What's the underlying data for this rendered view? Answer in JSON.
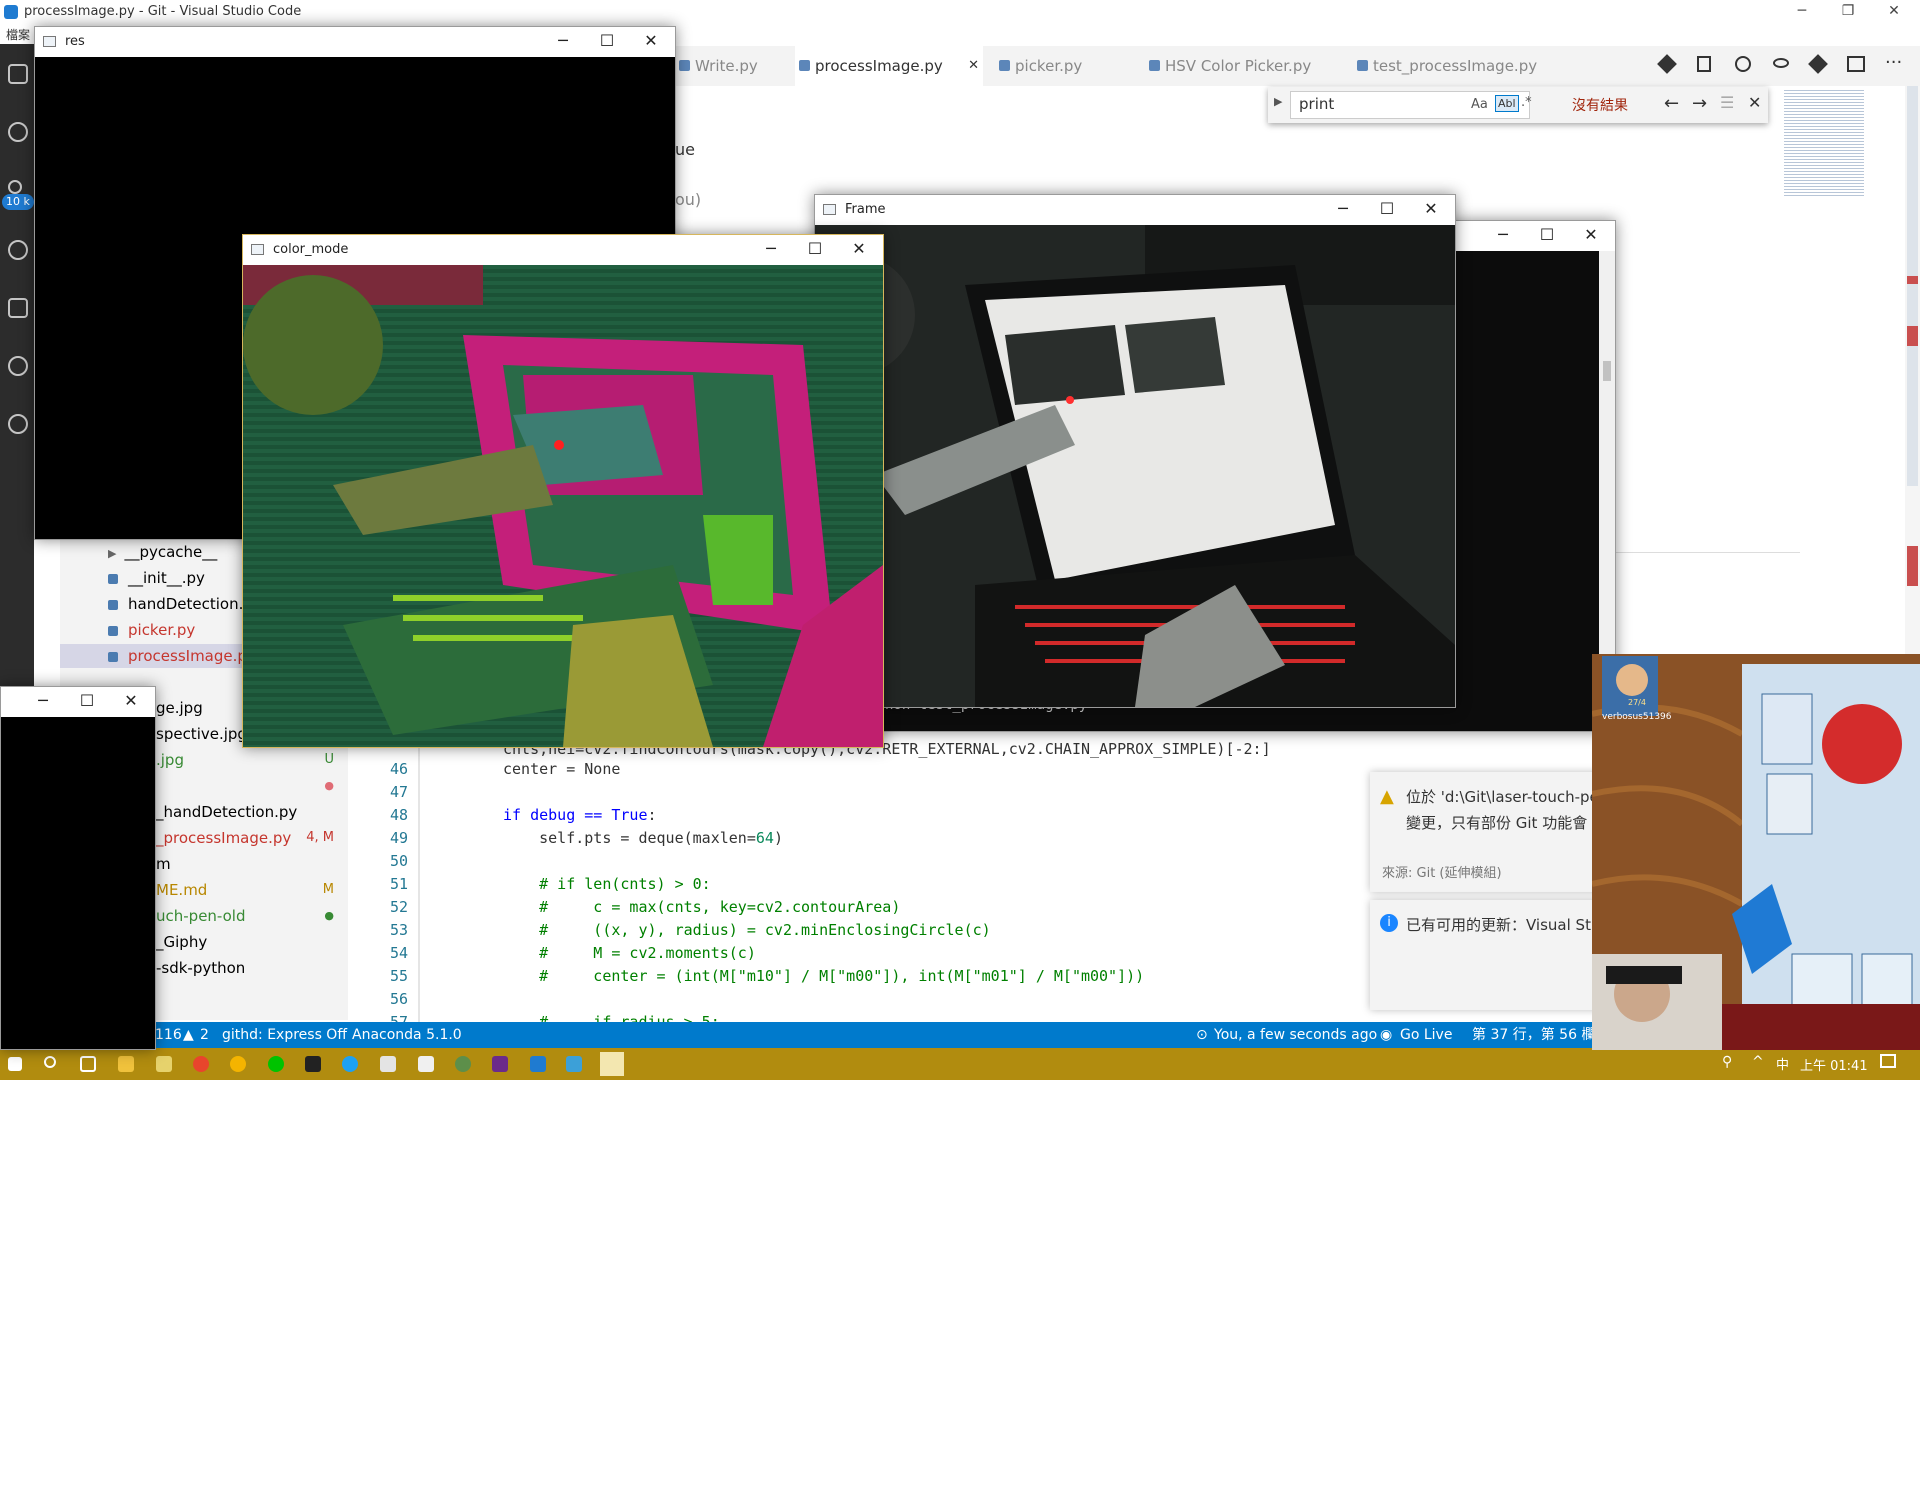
{
  "window": {
    "title": "processImage.py - Git - Visual Studio Code",
    "menu_first": "檔案"
  },
  "activity": {
    "scm_badge": "10 k"
  },
  "explorer": {
    "items": [
      {
        "label": "__pycache__",
        "color": "#333333"
      },
      {
        "label": "__init__.py",
        "color": "#333333"
      },
      {
        "label": "handDetection.p",
        "color": "#333333"
      },
      {
        "label": "picker.py",
        "color": "#c5362e"
      },
      {
        "label": "processImage.py",
        "color": "#c5362e"
      },
      {
        "label": "ge.jpg",
        "color": "#333333",
        "badge": ""
      },
      {
        "label": "spective.jpg",
        "color": "#333333",
        "badge": ""
      },
      {
        "label": ".jpg",
        "color": "#388a34",
        "badge": "U"
      },
      {
        "label": "",
        "color": "#333333",
        "badge": "●"
      },
      {
        "label": "_handDetection.py",
        "color": "#333333",
        "badge": ""
      },
      {
        "label": "_processImage.py",
        "color": "#c5362e",
        "badge": "4, M"
      },
      {
        "label": "m",
        "color": "#333333",
        "badge": ""
      },
      {
        "label": "ME.md",
        "color": "#b88700",
        "badge": "M"
      },
      {
        "label": "uch-pen-old",
        "color": "#388a34",
        "badge": "●"
      },
      {
        "label": "_Giphy",
        "color": "#333333",
        "badge": ""
      },
      {
        "label": "-sdk-python",
        "color": "#333333",
        "badge": ""
      }
    ]
  },
  "tabs": [
    {
      "label": "Write.py"
    },
    {
      "label": "processImage.py",
      "close": "✕"
    },
    {
      "label": "picker.py"
    },
    {
      "label": "HSV Color Picker.py"
    },
    {
      "label": "test_processImage.py"
    }
  ],
  "find": {
    "value": "print",
    "match_case": "Aa",
    "whole_word": "Abl",
    "regex": ".*",
    "result": "沒有結果"
  },
  "editor_partial": {
    "text1": "ue",
    "text2": "ou)",
    "terminal_text": "hon test_processImage.py"
  },
  "code": {
    "line_numbers": [
      "46",
      "47",
      "48",
      "49",
      "50",
      "51",
      "52",
      "53",
      "54",
      "55",
      "56",
      "57"
    ],
    "top_line": "cnts,hei=cv2.findContours(mask.copy(),cv2.RETR_EXTERNAL,cv2.CHAIN_APPROX_SIMPLE)[-2:]",
    "l46": "center = None",
    "l48a": "if debug == ",
    "l48b": "True",
    "l48c": ":",
    "l49a": "    self.pts = deque(maxlen=",
    "l49b": "64",
    "l49c": ")",
    "l51": "    # if len(cnts) > 0:",
    "l52": "    #     c = max(cnts, key=cv2.contourArea)",
    "l53": "    #     ((x, y), radius) = cv2.minEnclosingCircle(c)",
    "l54": "    #     M = cv2.moments(c)",
    "l55": "    #     center = (int(M[\"m10\"] / M[\"m00\"]), int(M[\"m01\"] / M[\"m00\"]))",
    "l57": "    #     if radius > 5:"
  },
  "notifications": [
    {
      "line1": "位於 'd:\\Git\\laser-touch-pe",
      "line2": "變更，只有部份 Git 功能會",
      "source": "來源: Git (延伸模組)"
    },
    {
      "line1": "已有可用的更新：Visual St"
    }
  ],
  "statusbar": {
    "problems": "116",
    "warnings": "2",
    "githd": "githd: Express Off",
    "python": "Anaconda 5.1.0",
    "blame": "You, a few seconds ago",
    "golive": "Go Live",
    "position": "第 37 行，第 56 欄"
  },
  "taskbar": {
    "ime": "中",
    "time": "上午 01:41"
  },
  "cv_windows": {
    "res": "res",
    "color_mode": "color_mode",
    "frame": "Frame"
  },
  "stream": {
    "username": "verbosus51396",
    "badge": "27/4"
  },
  "colors": {
    "accent": "#007acc",
    "taskbar": "#b18c0f",
    "modified": "#c5362e",
    "untracked": "#388a34"
  }
}
